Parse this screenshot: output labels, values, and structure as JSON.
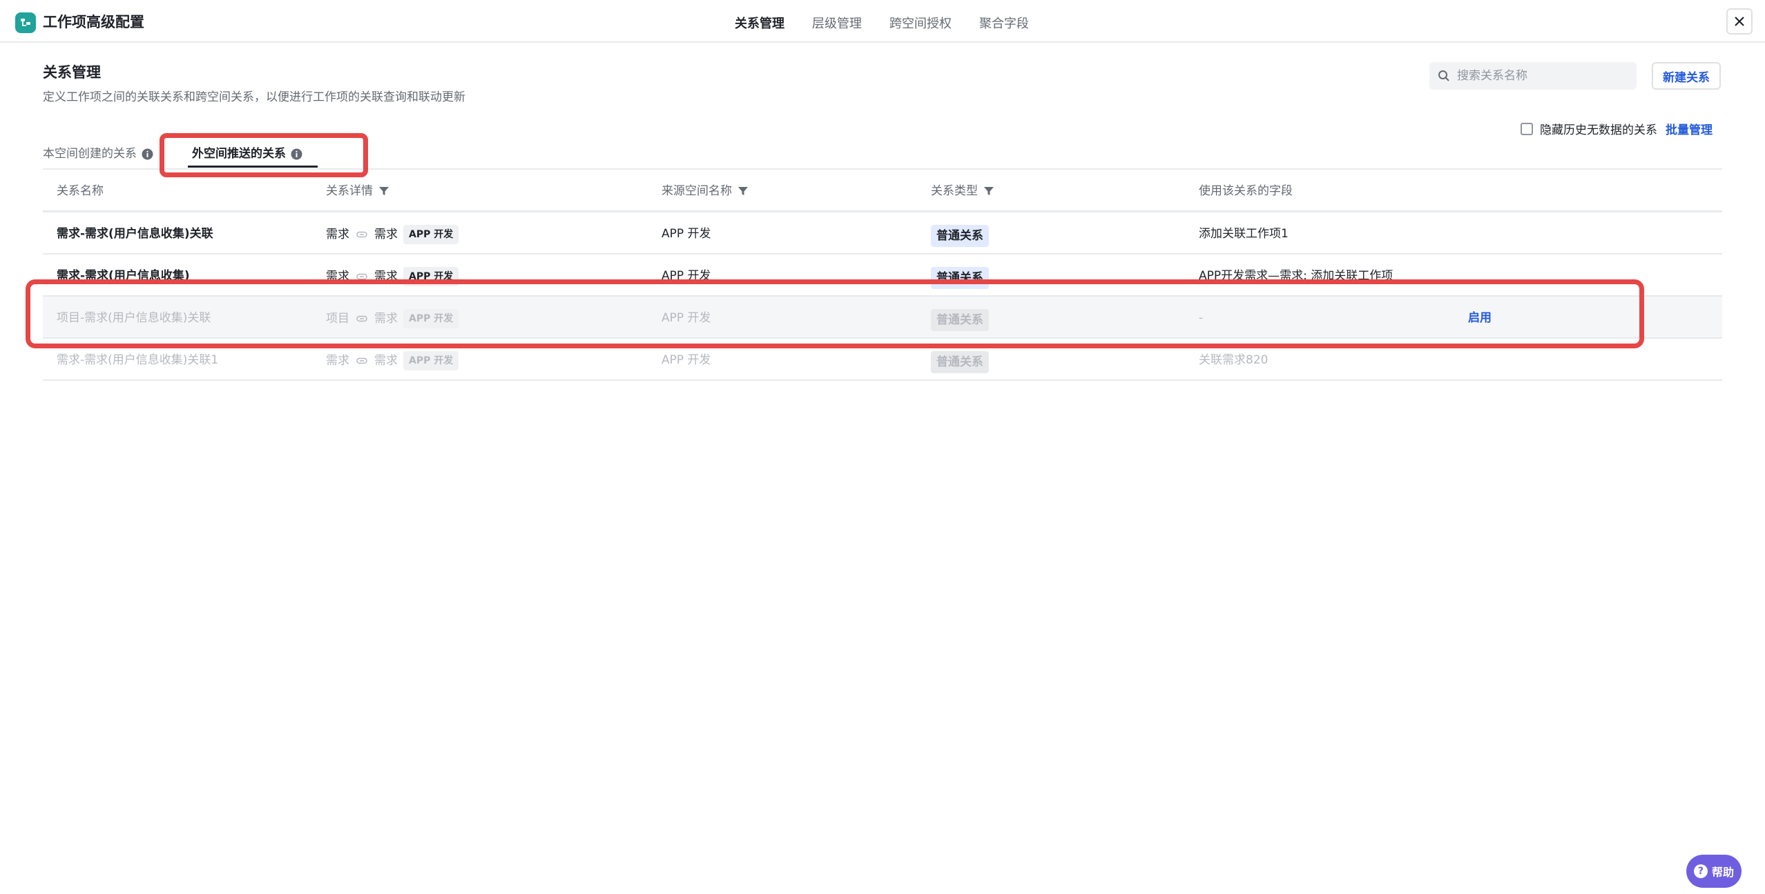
{
  "header": {
    "title": "工作项高级配置",
    "tabs": [
      {
        "label": "关系管理",
        "active": true
      },
      {
        "label": "层级管理",
        "active": false
      },
      {
        "label": "跨空间授权",
        "active": false
      },
      {
        "label": "聚合字段",
        "active": false
      }
    ],
    "close_icon": "close-icon"
  },
  "page": {
    "title": "关系管理",
    "description": "定义工作项之间的关联关系和跨空间关系，以便进行工作项的关联查询和联动更新",
    "search_placeholder": "搜索关系名称",
    "new_button": "新建关系",
    "hide_checkbox_label": "隐藏历史无数据的关系",
    "hide_checked": false,
    "batch_link": "批量管理"
  },
  "sub_tabs": [
    {
      "label": "本空间创建的关系",
      "active": false
    },
    {
      "label": "外空间推送的关系",
      "active": true
    }
  ],
  "table": {
    "columns": [
      "关系名称",
      "关系详情",
      "来源空间名称",
      "关系类型",
      "使用该关系的字段"
    ],
    "rows": [
      {
        "name": "需求-需求(用户信息收集)关联",
        "from": "需求",
        "to": "需求",
        "space_tag": "APP 开发",
        "source_space": "APP 开发",
        "type": "普通关系",
        "fields": "添加关联工作项1",
        "action": "",
        "disabled": false
      },
      {
        "name": "需求-需求(用户信息收集)",
        "from": "需求",
        "to": "需求",
        "space_tag": "APP 开发",
        "source_space": "APP 开发",
        "type": "普通关系",
        "fields": "APP开发需求—需求: 添加关联工作项",
        "action": "",
        "disabled": false
      },
      {
        "name": "项目-需求(用户信息收集)关联",
        "from": "项目",
        "to": "需求",
        "space_tag": "APP 开发",
        "source_space": "APP 开发",
        "type": "普通关系",
        "fields": "-",
        "action": "启用",
        "disabled": true
      },
      {
        "name": "需求-需求(用户信息收集)关联1",
        "from": "需求",
        "to": "需求",
        "space_tag": "APP 开发",
        "source_space": "APP 开发",
        "type": "普通关系",
        "fields": "关联需求820",
        "action": "",
        "disabled": true
      }
    ]
  },
  "help": {
    "label": "帮助"
  },
  "colors": {
    "accent": "#245bdb",
    "highlight": "#e64646",
    "brand": "#1fa39a",
    "help": "#6f5fe0"
  }
}
